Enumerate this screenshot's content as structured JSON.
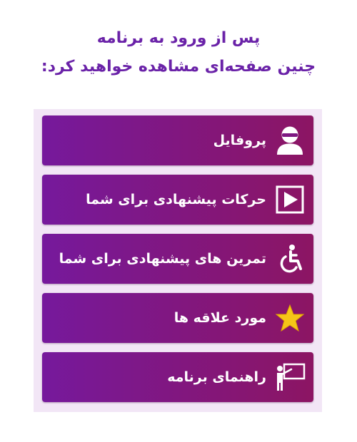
{
  "heading": {
    "line1": "پس از ورود به برنامه",
    "line2": "چنین صفحه‌ای مشاهده خواهید کرد:"
  },
  "colors": {
    "heading": "#6a22a8",
    "panel": "#f2e6f6",
    "item_gradient_start": "#76199c",
    "item_gradient_end": "#8c1563",
    "star": "#f5c518"
  },
  "menu": {
    "items": [
      {
        "label": "پروفایل",
        "icon": "profile-icon"
      },
      {
        "label": "حرکات پیشنهادی برای شما",
        "icon": "play-icon"
      },
      {
        "label": "تمرین های پیشنهادی برای شما",
        "icon": "wheelchair-icon"
      },
      {
        "label": "مورد علاقه ها",
        "icon": "star-icon"
      },
      {
        "label": "راهنمای برنامه",
        "icon": "teacher-board-icon"
      }
    ]
  }
}
